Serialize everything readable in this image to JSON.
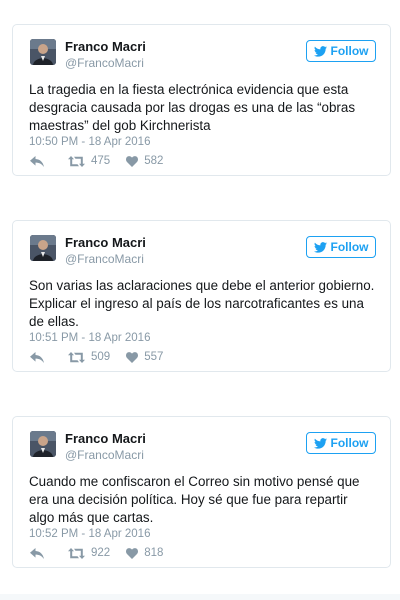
{
  "colors": {
    "accent": "#1da1f2",
    "muted": "#8899a6",
    "border": "#e1e8ed"
  },
  "tweets": [
    {
      "author": {
        "name": "Franco Macri",
        "handle": "@FrancoMacri",
        "avatar_icon": "avatar-photo"
      },
      "follow_label": "Follow",
      "text": "La tragedia en la fiesta electrónica evidencia que esta desgracia causada por las drogas es una de las “obras maestras” del gob Kirchnerista",
      "timestamp": "10:50 PM - 18 Apr 2016",
      "retweets": "475",
      "likes": "582"
    },
    {
      "author": {
        "name": "Franco Macri",
        "handle": "@FrancoMacri",
        "avatar_icon": "avatar-photo"
      },
      "follow_label": "Follow",
      "text": "Son varias las aclaraciones que debe el anterior gobierno. Explicar el ingreso al país de los narcotraficantes es una de ellas.",
      "timestamp": "10:51 PM - 18 Apr 2016",
      "retweets": "509",
      "likes": "557"
    },
    {
      "author": {
        "name": "Franco Macri",
        "handle": "@FrancoMacri",
        "avatar_icon": "avatar-photo"
      },
      "follow_label": "Follow",
      "text": "Cuando me confiscaron el Correo sin motivo pensé que era una decisión política. Hoy sé que fue para repartir algo más que cartas.",
      "timestamp": "10:52 PM - 18 Apr 2016",
      "retweets": "922",
      "likes": "818"
    }
  ]
}
